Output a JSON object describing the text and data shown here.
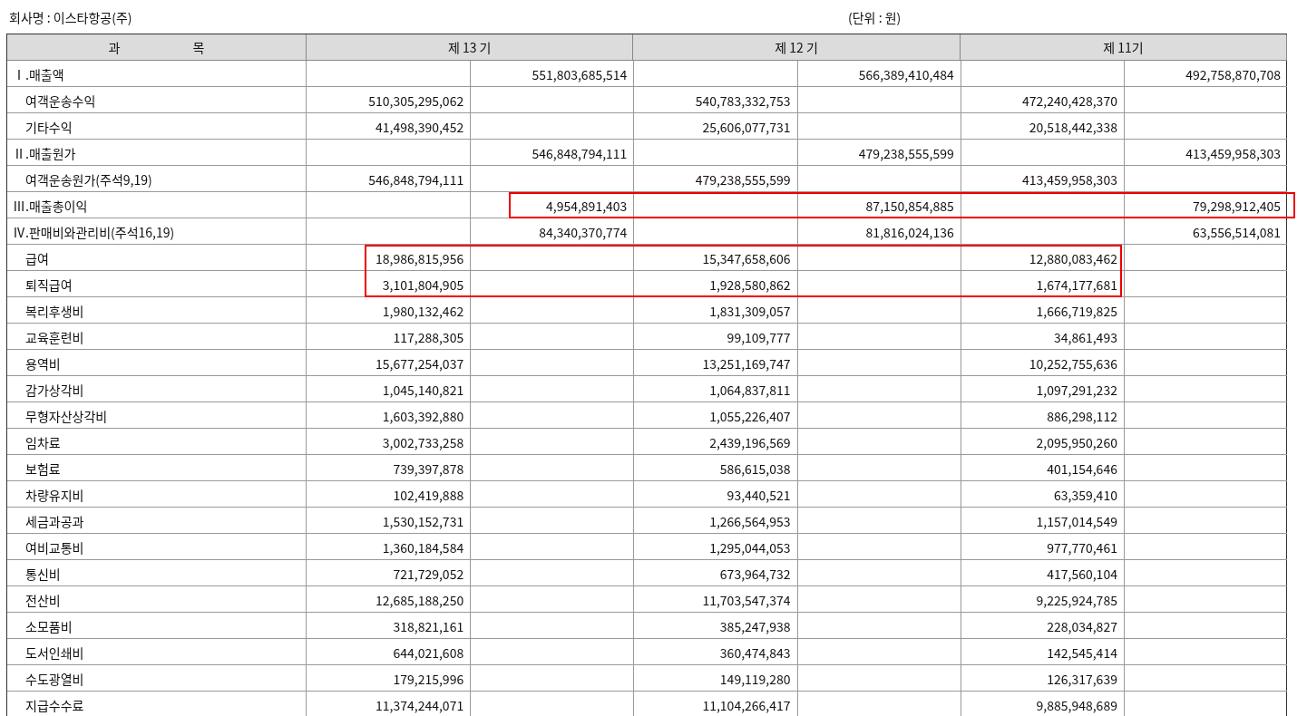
{
  "company": "회사명 : 이스타항공(주)",
  "unit": "(단위 : 원)",
  "columns": {
    "account": "과 목",
    "periods": [
      "제 13 기",
      "제 12 기",
      "제 11기"
    ]
  },
  "sections": [
    {
      "label": "Ⅰ.매출액",
      "cells": [
        null,
        {
          "text": "551,803,685,514"
        },
        null,
        {
          "text": "566,389,410,484"
        },
        null,
        {
          "text": "492,758,870,708"
        }
      ],
      "children": [
        {
          "label": "여객운송수익",
          "cells": [
            {
              "text": "510,305,295,062"
            },
            null,
            {
              "text": "540,783,332,753"
            },
            null,
            {
              "text": "472,240,428,370"
            },
            null
          ]
        },
        {
          "label": "기타수익",
          "cells": [
            {
              "text": "41,498,390,452"
            },
            null,
            {
              "text": "25,606,077,731"
            },
            null,
            {
              "text": "20,518,442,338"
            },
            null
          ]
        }
      ]
    },
    {
      "label": "Ⅱ.매출원가",
      "cells": [
        null,
        {
          "text": "546,848,794,111"
        },
        null,
        {
          "text": "479,238,555,599"
        },
        null,
        {
          "text": "413,459,958,303"
        }
      ],
      "children": [
        {
          "label": "여객운송원가(주석9,19)",
          "cells": [
            {
              "text": "546,848,794,111"
            },
            null,
            {
              "text": "479,238,555,599"
            },
            null,
            {
              "text": "413,459,958,303"
            },
            null
          ]
        }
      ]
    },
    {
      "label": "Ⅲ.매출총이익",
      "boxed": true,
      "cells": [
        null,
        {
          "text": "4,954,891,403"
        },
        null,
        {
          "text": "87,150,854,885"
        },
        null,
        {
          "text": "79,298,912,405"
        }
      ]
    },
    {
      "label": "Ⅳ.판매비와관리비(주석16,19)",
      "cells": [
        null,
        {
          "text": "84,340,370,774"
        },
        null,
        {
          "text": "81,816,024,136"
        },
        null,
        {
          "text": "63,556,514,081"
        }
      ],
      "children": [
        {
          "label": "급여",
          "boxed": true,
          "cells": [
            {
              "text": "18,986,815,956"
            },
            null,
            {
              "text": "15,347,658,606"
            },
            null,
            {
              "text": "12,880,083,462"
            },
            null
          ]
        },
        {
          "label": "퇴직급여",
          "boxed": true,
          "cells": [
            {
              "text": "3,101,804,905"
            },
            null,
            {
              "text": "1,928,580,862"
            },
            null,
            {
              "text": "1,674,177,681"
            },
            null
          ]
        },
        {
          "label": "복리후생비",
          "cells": [
            {
              "text": "1,980,132,462"
            },
            null,
            {
              "text": "1,831,309,057"
            },
            null,
            {
              "text": "1,666,719,825"
            },
            null
          ]
        },
        {
          "label": "교육훈련비",
          "cells": [
            {
              "text": "117,288,305"
            },
            null,
            {
              "text": "99,109,777"
            },
            null,
            {
              "text": "34,861,493"
            },
            null
          ]
        },
        {
          "label": "용역비",
          "cells": [
            {
              "text": "15,677,254,037"
            },
            null,
            {
              "text": "13,251,169,747"
            },
            null,
            {
              "text": "10,252,755,636"
            },
            null
          ]
        },
        {
          "label": "감가상각비",
          "cells": [
            {
              "text": "1,045,140,821"
            },
            null,
            {
              "text": "1,064,837,811"
            },
            null,
            {
              "text": "1,097,291,232"
            },
            null
          ]
        },
        {
          "label": "무형자산상각비",
          "cells": [
            {
              "text": "1,603,392,880"
            },
            null,
            {
              "text": "1,055,226,407"
            },
            null,
            {
              "text": "886,298,112"
            },
            null
          ]
        },
        {
          "label": "임차료",
          "cells": [
            {
              "text": "3,002,733,258"
            },
            null,
            {
              "text": "2,439,196,569"
            },
            null,
            {
              "text": "2,095,950,260"
            },
            null
          ]
        },
        {
          "label": "보험료",
          "cells": [
            {
              "text": "739,397,878"
            },
            null,
            {
              "text": "586,615,038"
            },
            null,
            {
              "text": "401,154,646"
            },
            null
          ]
        },
        {
          "label": "차량유지비",
          "cells": [
            {
              "text": "102,419,888"
            },
            null,
            {
              "text": "93,440,521"
            },
            null,
            {
              "text": "63,359,410"
            },
            null
          ]
        },
        {
          "label": "세금과공과",
          "cells": [
            {
              "text": "1,530,152,731"
            },
            null,
            {
              "text": "1,266,564,953"
            },
            null,
            {
              "text": "1,157,014,549"
            },
            null
          ]
        },
        {
          "label": "여비교통비",
          "cells": [
            {
              "text": "1,360,184,584"
            },
            null,
            {
              "text": "1,295,044,053"
            },
            null,
            {
              "text": "977,770,461"
            },
            null
          ]
        },
        {
          "label": "통신비",
          "cells": [
            {
              "text": "721,729,052"
            },
            null,
            {
              "text": "673,964,732"
            },
            null,
            {
              "text": "417,560,104"
            },
            null
          ]
        },
        {
          "label": "전산비",
          "cells": [
            {
              "text": "12,685,188,250"
            },
            null,
            {
              "text": "11,703,547,374"
            },
            null,
            {
              "text": "9,225,924,785"
            },
            null
          ]
        },
        {
          "label": "소모품비",
          "cells": [
            {
              "text": "318,821,161"
            },
            null,
            {
              "text": "385,247,938"
            },
            null,
            {
              "text": "228,034,827"
            },
            null
          ]
        },
        {
          "label": "도서인쇄비",
          "cells": [
            {
              "text": "644,021,608"
            },
            null,
            {
              "text": "360,474,843"
            },
            null,
            {
              "text": "142,545,414"
            },
            null
          ]
        },
        {
          "label": "수도광열비",
          "cells": [
            {
              "text": "179,215,996"
            },
            null,
            {
              "text": "149,119,280"
            },
            null,
            {
              "text": "126,317,639"
            },
            null
          ]
        },
        {
          "label": "지급수수료",
          "cells": [
            {
              "text": "11,374,244,071"
            },
            null,
            {
              "text": "11,104,266,417"
            },
            null,
            {
              "text": "9,885,948,689"
            },
            null
          ]
        }
      ]
    }
  ]
}
